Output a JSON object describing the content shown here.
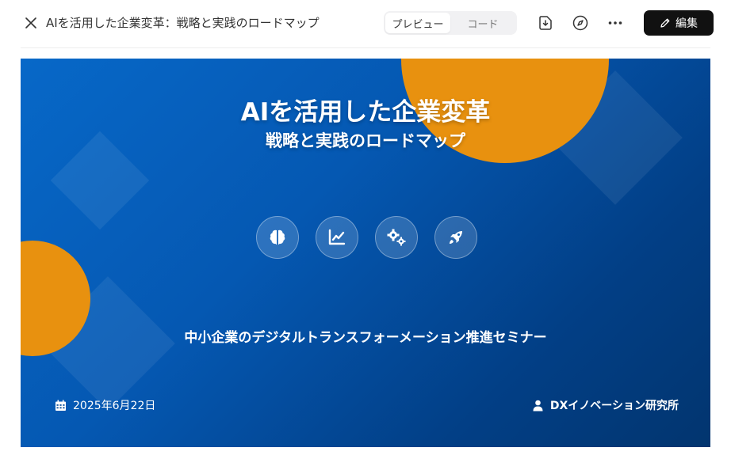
{
  "header": {
    "title": "AIを活用した企業変革：戦略と実践のロードマップ",
    "tabs": [
      {
        "label": "プレビュー",
        "active": true
      },
      {
        "label": "コード",
        "active": false
      }
    ],
    "edit_label": "編集",
    "icons": [
      "close-icon",
      "download-icon",
      "compass-icon",
      "more-icon",
      "pencil-icon"
    ]
  },
  "slide": {
    "title": "AIを活用した企業変革",
    "subtitle": "戦略と実践のロードマップ",
    "feature_icons": [
      "brain-icon",
      "chart-line-icon",
      "gears-icon",
      "rocket-icon"
    ],
    "seminar": "中小企業のデジタルトランスフォーメーション推進セミナー",
    "date": "2025年6月22日",
    "organizer": "DXイノベーション研究所",
    "colors": {
      "gradient_start": "#0768c8",
      "gradient_end": "#02356f",
      "accent": "#e8910f",
      "edit_button": "#111111"
    }
  }
}
